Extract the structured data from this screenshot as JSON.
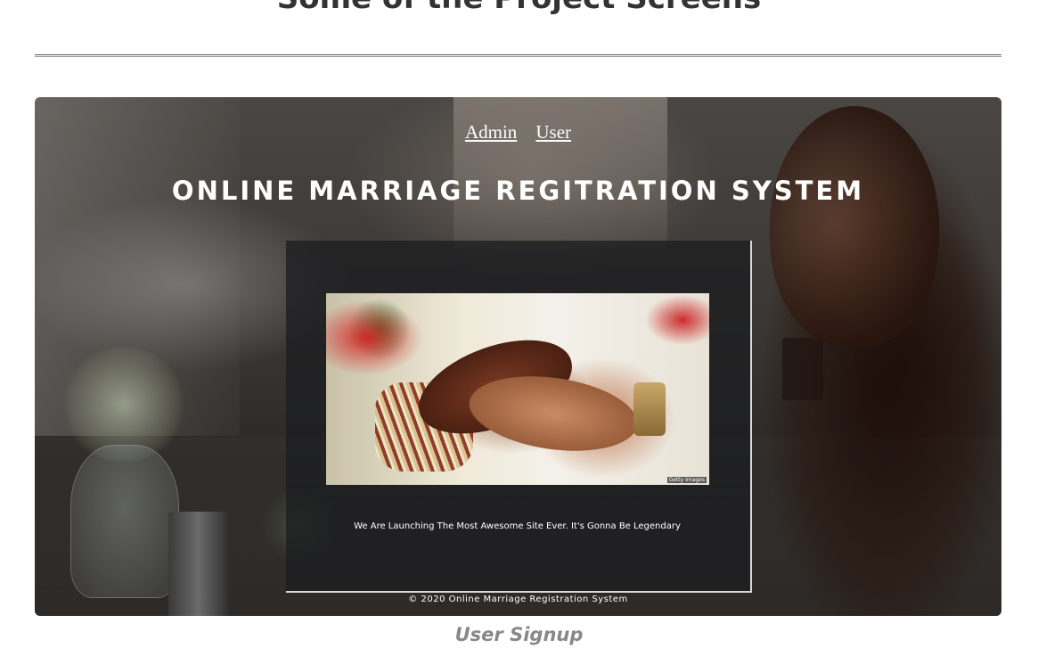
{
  "section": {
    "heading": "Some of the Project Screens"
  },
  "screenshot": {
    "nav": {
      "admin_link": "Admin",
      "user_link": "User"
    },
    "site_title": "ONLINE MARRIAGE REGITRATION SYSTEM",
    "hero": {
      "image_credit": "Getty Images"
    },
    "tagline": "We Are Launching The Most Awesome Site Ever. It's Gonna Be Legendary",
    "footer": "© 2020 Online Marriage Registration System"
  },
  "caption": "User Signup",
  "colors": {
    "heading": "#333333",
    "caption": "#888888",
    "overlay_text": "#ffffff"
  }
}
